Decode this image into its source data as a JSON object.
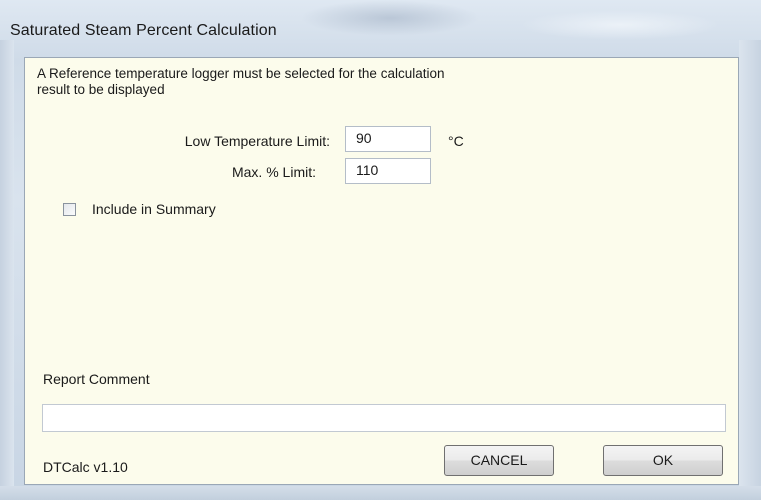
{
  "window": {
    "title": "Saturated Steam Percent Calculation"
  },
  "message": "A Reference temperature logger must be selected for the calculation result to be displayed",
  "low_temp": {
    "label": "Low Temperature Limit:",
    "value": "90",
    "unit": "°C"
  },
  "max_limit": {
    "label": "Max. % Limit:",
    "value": "110"
  },
  "include_summary": {
    "label": "Include in Summary",
    "checked": false
  },
  "report_comment": {
    "label": "Report Comment",
    "value": ""
  },
  "version": "DTCalc v1.10",
  "buttons": {
    "cancel": "CANCEL",
    "ok": "OK"
  }
}
